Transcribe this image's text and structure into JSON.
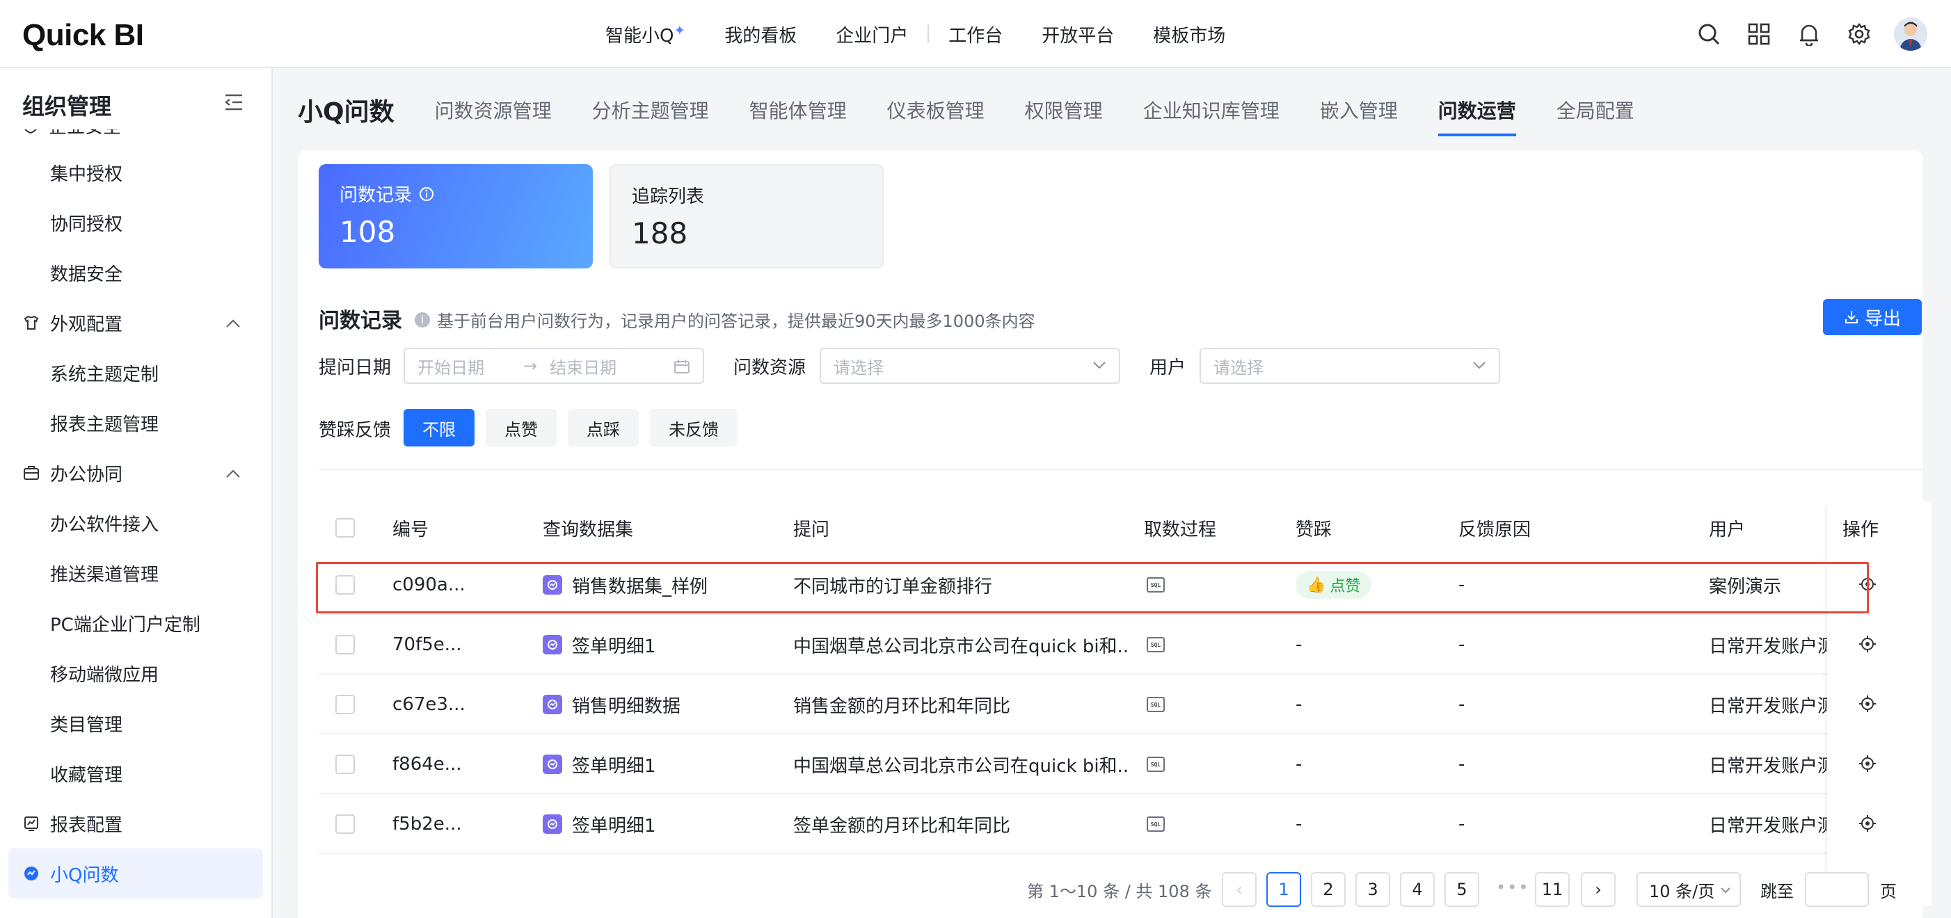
{
  "brand": {
    "logo": "Quick BI"
  },
  "topnav": [
    "智能小Q",
    "我的看板",
    "企业门户",
    "工作台",
    "开放平台",
    "模板市场"
  ],
  "sidebar": {
    "title": "组织管理",
    "clipped_item": "企业安全",
    "items": [
      {
        "label": "集中授权"
      },
      {
        "label": "协同授权"
      },
      {
        "label": "数据安全"
      },
      {
        "label": "外观配置"
      },
      {
        "label": "系统主题定制"
      },
      {
        "label": "报表主题管理"
      },
      {
        "label": "办公协同"
      },
      {
        "label": "办公软件接入"
      },
      {
        "label": "推送渠道管理"
      },
      {
        "label": "PC端企业门户定制"
      },
      {
        "label": "移动端微应用"
      },
      {
        "label": "类目管理"
      },
      {
        "label": "收藏管理"
      },
      {
        "label": "报表配置"
      },
      {
        "label": "小Q问数"
      }
    ]
  },
  "tabs": {
    "title": "小Q问数",
    "items": [
      "问数资源管理",
      "分析主题管理",
      "智能体管理",
      "仪表板管理",
      "权限管理",
      "企业知识库管理",
      "嵌入管理",
      "问数运营",
      "全局配置"
    ]
  },
  "stats": [
    {
      "label": "问数记录",
      "value": "108"
    },
    {
      "label": "追踪列表",
      "value": "188"
    }
  ],
  "section": {
    "title": "问数记录",
    "desc": "基于前台用户问数行为，记录用户的问答记录，提供最近90天内最多1000条内容",
    "export": "导出"
  },
  "filters": {
    "date_label": "提问日期",
    "start_placeholder": "开始日期",
    "end_placeholder": "结束日期",
    "resource_label": "问数资源",
    "resource_placeholder": "请选择",
    "user_label": "用户",
    "user_placeholder": "请选择",
    "feedback_label": "赞踩反馈",
    "feedback_options": [
      "不限",
      "点赞",
      "点踩",
      "未反馈"
    ]
  },
  "table": {
    "columns": [
      "编号",
      "查询数据集",
      "提问",
      "取数过程",
      "赞踩",
      "反馈原因",
      "用户",
      "操作"
    ],
    "rows": [
      {
        "id": "c090a...",
        "dataset": "销售数据集_样例",
        "question": "不同城市的订单金额排行",
        "vote": "点赞",
        "reason": "-",
        "user": "案例演示"
      },
      {
        "id": "70f5e...",
        "dataset": "签单明细1",
        "question": "中国烟草总公司北京市公司在quick bi和...",
        "vote": "-",
        "reason": "-",
        "user": "日常开发账户测"
      },
      {
        "id": "c67e3...",
        "dataset": "销售明细数据",
        "question": "销售金额的月环比和年同比",
        "vote": "-",
        "reason": "-",
        "user": "日常开发账户测"
      },
      {
        "id": "f864e...",
        "dataset": "签单明细1",
        "question": "中国烟草总公司北京市公司在quick bi和...",
        "vote": "-",
        "reason": "-",
        "user": "日常开发账户测"
      },
      {
        "id": "f5b2e...",
        "dataset": "签单明细1",
        "question": "签单金额的月环比和年同比",
        "vote": "-",
        "reason": "-",
        "user": "日常开发账户测"
      }
    ]
  },
  "pagination": {
    "summary": "第 1～10 条 / 共 108 条",
    "pages": [
      "1",
      "2",
      "3",
      "4",
      "5",
      "11"
    ],
    "ellipsis": "•••",
    "page_size": "10 条/页",
    "jump_label": "跳至",
    "jump_suffix": "页"
  },
  "colors": {
    "accent": "#1f6fff",
    "highlight": "#e8483e",
    "like": "#1aa64a"
  }
}
